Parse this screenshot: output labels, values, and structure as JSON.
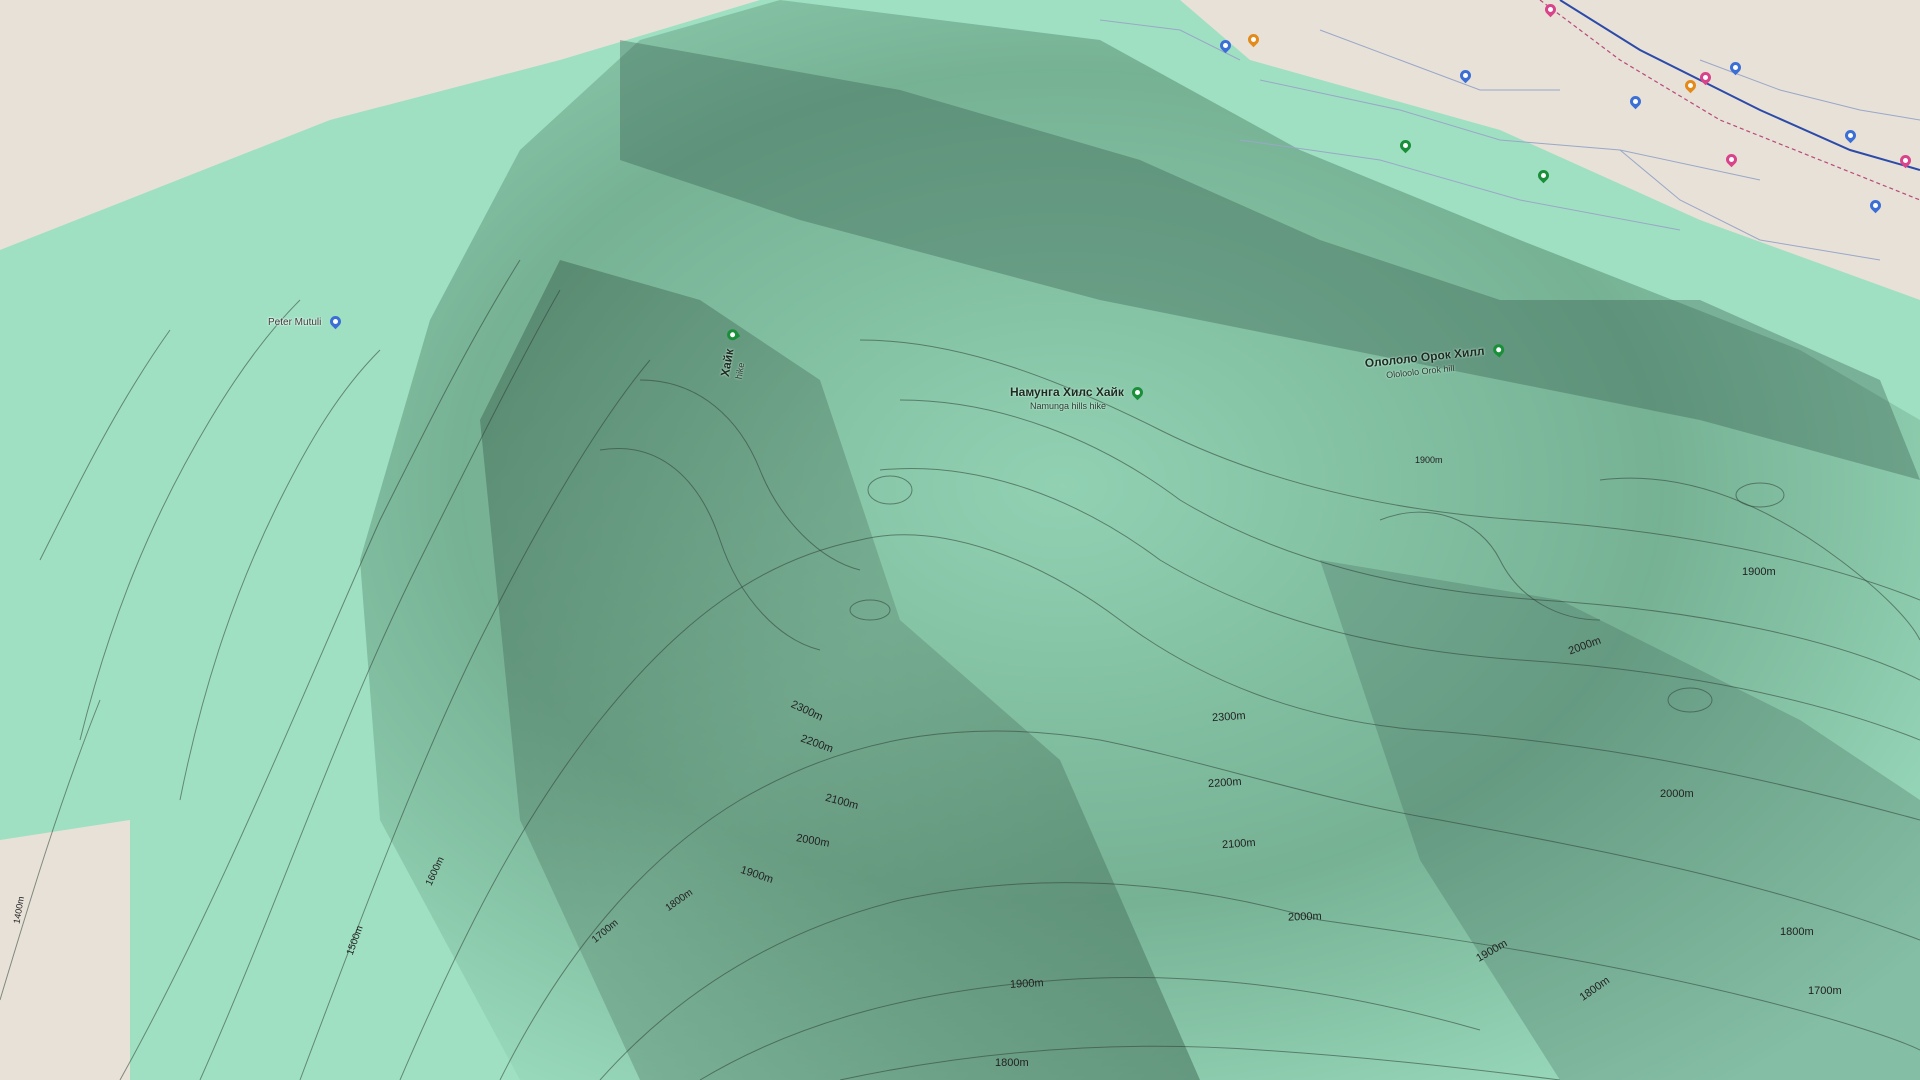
{
  "map": {
    "colors": {
      "background": "#e7e1d8",
      "park": "#9fe0c2",
      "park_shadow": "#3f6b55",
      "contour": "#2f3f37",
      "road": "#9aa7c8",
      "highway": "#2c4aa8",
      "rail": "#b84a7a"
    },
    "contour_labels": [
      "1800m",
      "1900m",
      "2000m",
      "2100m",
      "2200m",
      "2300m",
      "1900m",
      "2000m",
      "2100m",
      "2200m",
      "2300m",
      "1700m",
      "1800m",
      "1900m",
      "2000m",
      "1800m",
      "1900m",
      "2000m",
      "1900m",
      "1600m",
      "1500m",
      "1400m",
      "1700m",
      "1800m"
    ],
    "trails": [
      {
        "name": "Намунга Хилс Хайк",
        "sub": "Namunga hills hike",
        "icon": "hiking-icon"
      },
      {
        "name": "Олололо Орок Хилл",
        "sub": "Ololoolo Orok hill",
        "icon": "hiking-icon"
      },
      {
        "name": "Хайк",
        "sub": "hike",
        "icon": "hiking-icon"
      }
    ],
    "places": [
      {
        "name": "Peter Mutuli",
        "icon": "place-pin-icon"
      }
    ]
  }
}
